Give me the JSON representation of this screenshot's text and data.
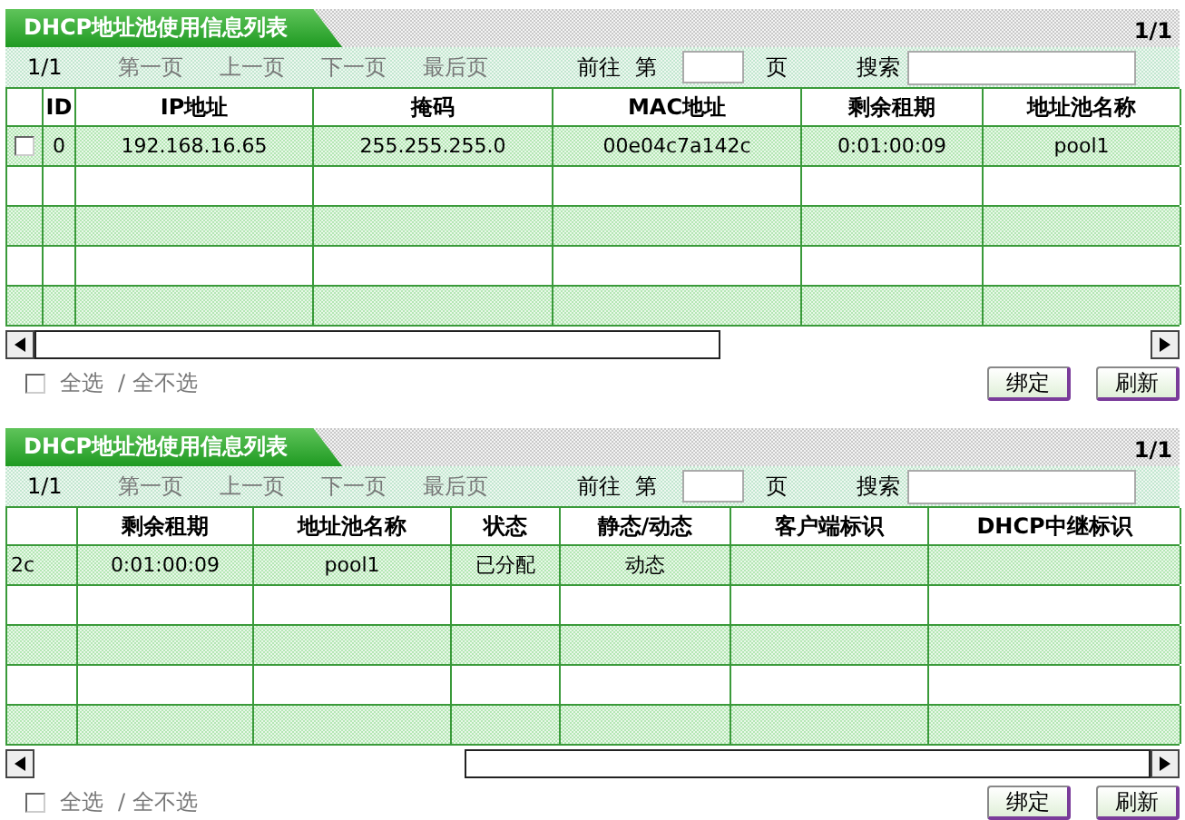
{
  "panels": [
    {
      "title": "DHCP地址池使用信息列表",
      "page_count": "1/1",
      "scrolled": false,
      "pager": {
        "current": "1/1",
        "links": [
          {
            "label": "第一页",
            "disabled": true
          },
          {
            "label": "上一页",
            "disabled": true
          },
          {
            "label": "下一页",
            "disabled": true
          },
          {
            "label": "最后页",
            "disabled": true
          }
        ],
        "goto_label": "前往",
        "page_prefix": "第",
        "page_suffix": "页",
        "search_label": "搜索"
      },
      "columns": [
        "ID",
        "IP地址",
        "掩码",
        "MAC地址",
        "剩余租期",
        "地址池名称"
      ],
      "rows": [
        {
          "checked": false,
          "cells": [
            "0",
            "192.168.16.65",
            "255.255.255.0",
            "00e04c7a142c",
            "0:01:00:09",
            "pool1"
          ]
        }
      ],
      "select_all": {
        "checked": false,
        "label": "全选",
        "label_none": "/ 全不选"
      },
      "buttons": [
        "绑定",
        "刷新"
      ]
    },
    {
      "title": "DHCP地址池使用信息列表",
      "page_count": "1/1",
      "scrolled": true,
      "pager": {
        "current": "1/1",
        "links": [
          {
            "label": "第一页",
            "disabled": true
          },
          {
            "label": "上一页",
            "disabled": true
          },
          {
            "label": "下一页",
            "disabled": true
          },
          {
            "label": "最后页",
            "disabled": true
          }
        ],
        "goto_label": "前往",
        "page_prefix": "第",
        "page_suffix": "页",
        "search_label": "搜索"
      },
      "columns": [
        "",
        "剩余租期",
        "地址池名称",
        "状态",
        "静态/动态",
        "客户端标识",
        "DHCP中继标识"
      ],
      "rows": [
        {
          "cells": [
            "2c",
            "0:01:00:09",
            "pool1",
            "已分配",
            "动态"
          ]
        }
      ],
      "select_all": {
        "checked": false,
        "label": "全选",
        "label_none": "/ 全不选"
      },
      "buttons": [
        "绑定",
        "刷新"
      ]
    }
  ]
}
